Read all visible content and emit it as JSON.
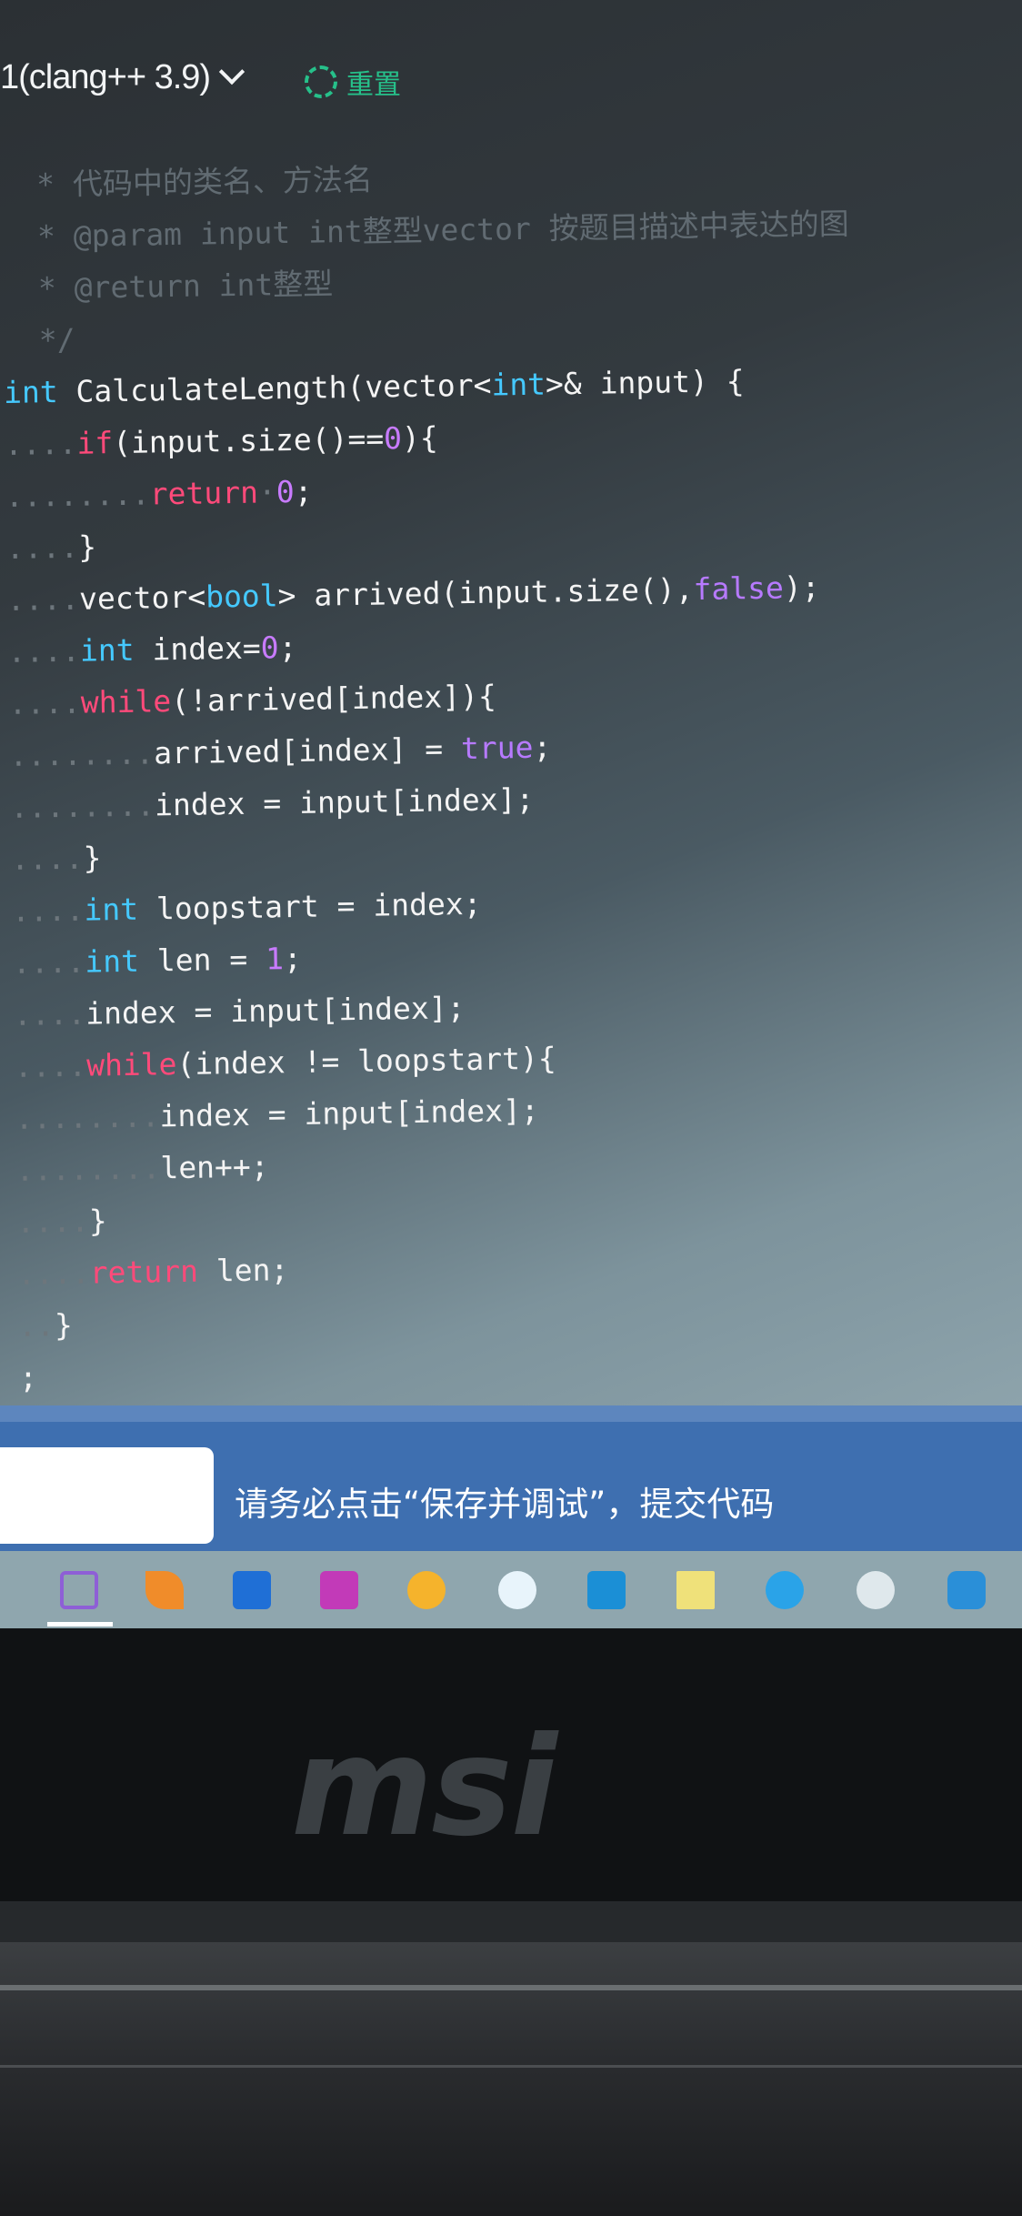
{
  "editor": {
    "language_selector": "1(clang++ 3.9)",
    "reset_label": "重置",
    "comment_lines": [
      "  * 代码中的类名、方法名",
      "  * @param input int整型vector 按题目描述中表达的图",
      "  * @return int整型",
      "  */"
    ]
  },
  "code": {
    "l1_type": "int",
    "l1_rest": " CalculateLength(vector<",
    "l1_type2": "int",
    "l1_end": ">& input) {",
    "l2_kw": "if",
    "l2_a": "(input.size()==",
    "l2_num": "0",
    "l2_b": "){",
    "l3_kw": "return",
    "l3_num": "0",
    "l3_end": ";",
    "l4": "}",
    "l5_a": "vector<",
    "l5_type": "bool",
    "l5_b": "> arrived(input.size(),",
    "l5_bool": "false",
    "l5_c": ");",
    "l6_type": "int",
    "l6_a": " index=",
    "l6_num": "0",
    "l6_b": ";",
    "l7_kw": "while",
    "l7_a": "(!arrived[index]){",
    "l8_a": "arrived[index] = ",
    "l8_bool": "true",
    "l8_b": ";",
    "l9": "index = input[index];",
    "l10": "}",
    "l11_type": "int",
    "l11_a": " loopstart = index;",
    "l12_type": "int",
    "l12_a": " len = ",
    "l12_num": "1",
    "l12_b": ";",
    "l13": "index = input[index];",
    "l14_kw": "while",
    "l14_a": "(index != loopstart){",
    "l15": "index = input[index];",
    "l16": "len++;",
    "l17": "}",
    "l18_kw": "return",
    "l18_a": " len;",
    "l19": "}",
    "l20": ";"
  },
  "footer": {
    "notice": "请务必点击“保存并调试”，提交代码"
  },
  "taskbar": {
    "icons": [
      "visual-studio-icon",
      "matlab-icon",
      "photoshop-icon",
      "onenote-icon",
      "app-icon",
      "browser-icon",
      "image-app-icon",
      "sticky-notes-icon",
      "chat-icon",
      "qq-icon",
      "cloud-icon"
    ],
    "colors": [
      "#8e5fd6",
      "#f08c2a",
      "#1f6fd6",
      "#c23ab8",
      "#f5b32c",
      "#e8f4fb",
      "#1b8fd6",
      "#efe17a",
      "#2aa3e8",
      "#dfe8ec",
      "#2a8fd8"
    ]
  },
  "laptop": {
    "brand": "msi"
  }
}
